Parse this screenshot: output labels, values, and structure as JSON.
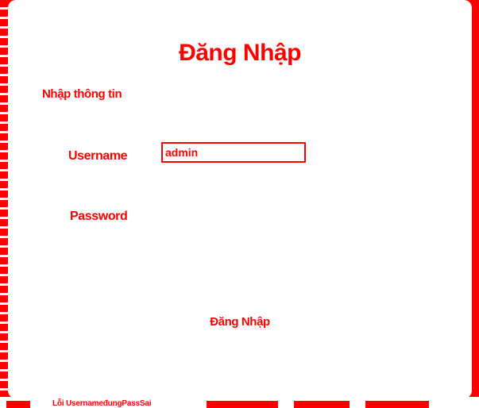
{
  "colors": {
    "accent": "#ff0000",
    "background": "#ffffff"
  },
  "login": {
    "title": "Đăng Nhập",
    "section_label": "Nhập thông tin",
    "username_label": "Username",
    "username_value": "admin",
    "password_label": "Password",
    "password_value": "",
    "submit_label": "Đăng Nhập"
  },
  "bottom_bar": {
    "caption": "Lỗi UsernameđungPassSai"
  }
}
